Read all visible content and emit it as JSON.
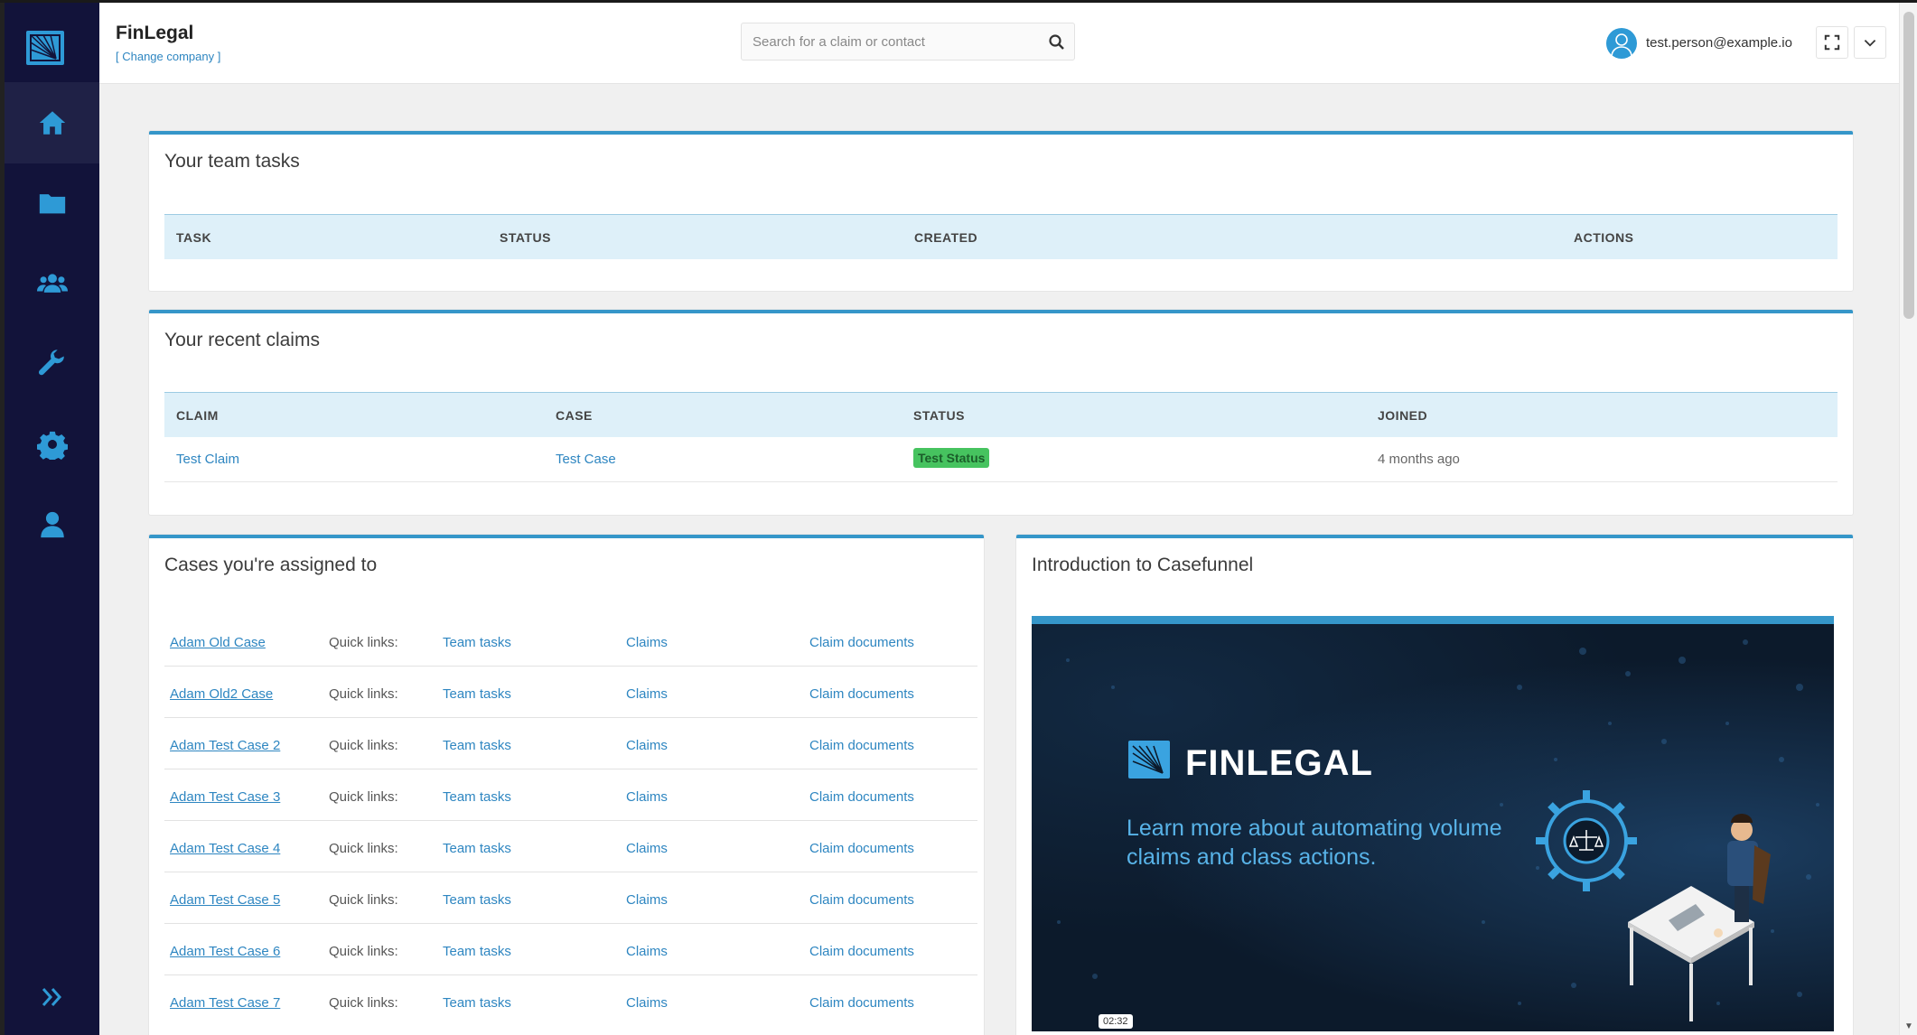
{
  "header": {
    "company_name": "FinLegal",
    "change_company": "[ Change company ]",
    "search_placeholder": "Search for a claim or contact",
    "user_email": "test.person@example.io"
  },
  "sidebar": {
    "items": [
      {
        "name": "home",
        "icon": "home-icon",
        "active": true
      },
      {
        "name": "folders",
        "icon": "folder-icon"
      },
      {
        "name": "contacts",
        "icon": "users-icon"
      },
      {
        "name": "tools",
        "icon": "wrench-icon"
      },
      {
        "name": "settings",
        "icon": "gear-icon"
      },
      {
        "name": "profile",
        "icon": "user-icon"
      }
    ],
    "expand_icon": "double-chevron-right-icon"
  },
  "team_tasks": {
    "title": "Your team tasks",
    "columns": [
      "TASK",
      "STATUS",
      "CREATED",
      "ACTIONS"
    ],
    "rows": []
  },
  "recent_claims": {
    "title": "Your recent claims",
    "columns": [
      "CLAIM",
      "CASE",
      "STATUS",
      "JOINED"
    ],
    "rows": [
      {
        "claim": "Test Claim",
        "case": "Test Case",
        "status": "Test Status",
        "joined": "4 months ago"
      }
    ]
  },
  "assigned_cases": {
    "title": "Cases you're assigned to",
    "quick_links_label": "Quick links:",
    "link_labels": [
      "Team tasks",
      "Claims",
      "Claim documents"
    ],
    "cases": [
      "Adam Old Case",
      "Adam Old2 Case",
      "Adam Test Case 2",
      "Adam Test Case 3",
      "Adam Test Case 4",
      "Adam Test Case 5",
      "Adam Test Case 6",
      "Adam Test Case 7"
    ]
  },
  "intro": {
    "title": "Introduction to Casefunnel",
    "video": {
      "brand": "FINLEGAL",
      "tagline": "Learn more about automating volume claims and class actions.",
      "duration": "02:32"
    }
  },
  "colors": {
    "sidebar_bg": "#12133a",
    "accent": "#3596c9",
    "link": "#2e86c1",
    "status_badge": "#46c35f"
  }
}
